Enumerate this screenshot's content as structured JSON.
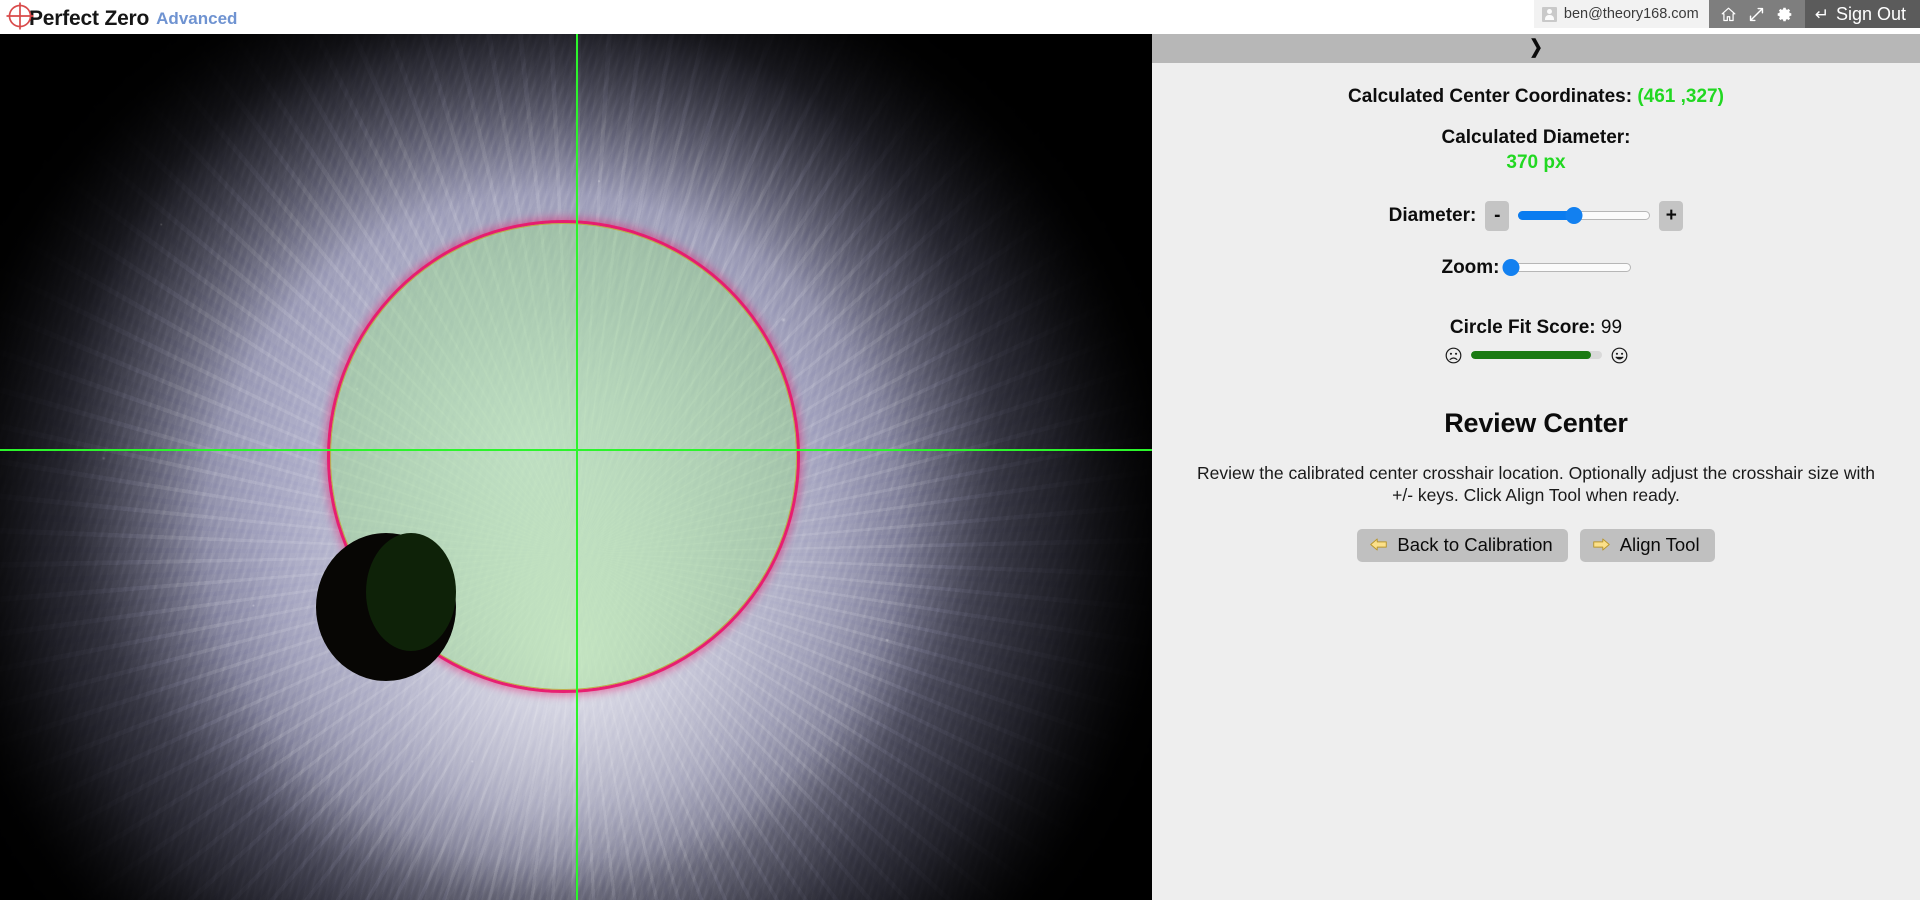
{
  "header": {
    "brand_title": "Perfect Zero",
    "brand_subtitle": "Advanced",
    "logo_icon": "crosshair-target-icon",
    "account_email": "ben@theory168.com",
    "account_icon": "user-icon",
    "home_icon": "home-icon",
    "fullscreen_icon": "expand-arrows-icon",
    "settings_icon": "gear-icon",
    "signout_icon": "enter-arrow-icon",
    "signout_label": "Sign Out"
  },
  "viewport": {
    "name": "microscope-live-view",
    "crosshair_color": "#2bf52b",
    "fit_circle_color": "#e8196e",
    "fit_fill_color": "rgba(150,230,130,0.40)"
  },
  "panel": {
    "collapse_icon": "chevron-right-icon",
    "readouts": {
      "center_label": "Calculated Center Coordinates:",
      "center_value": "(461 ,327)",
      "diameter_label": "Calculated Diameter:",
      "diameter_value": "370 px",
      "value_color": "#21d821"
    },
    "controls": {
      "diameter_label": "Diameter:",
      "diameter_minus": "-",
      "diameter_plus": "+",
      "diameter_percent": 42,
      "zoom_label": "Zoom:",
      "zoom_percent": 0,
      "accent_color": "#1280f0"
    },
    "score": {
      "label": "Circle Fit Score:",
      "value": "99",
      "percent": 92,
      "bar_color": "#1a7a12",
      "sad_icon": "frowning-face-icon",
      "happy_icon": "smiling-face-icon"
    },
    "step": {
      "title": "Review Center",
      "description": "Review the calibrated center crosshair location. Optionally adjust the crosshair size with +/- keys. Click Align Tool when ready.",
      "back_label": "Back to Calibration",
      "back_icon": "arrow-left-icon",
      "next_label": "Align Tool",
      "next_icon": "arrow-right-icon"
    }
  }
}
